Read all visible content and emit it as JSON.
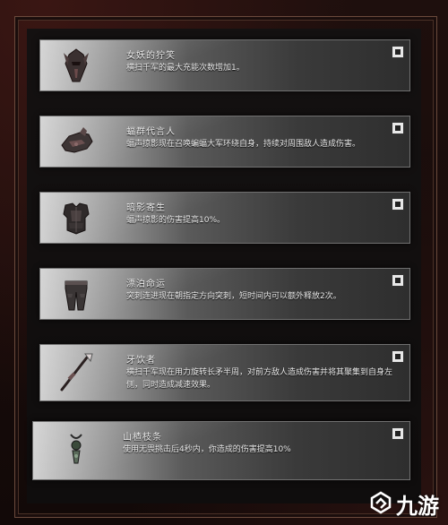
{
  "skills": [
    {
      "title": "女妖的狞笑",
      "desc": "横扫千军的最大充能次数增加1。",
      "icon": "helmet-icon"
    },
    {
      "title": "蝠群代言人",
      "desc": "蝠声掠影现在召唤蝙蝠大军环绕自身，持续对周围敌人造成伤害。",
      "icon": "gauntlet-icon"
    },
    {
      "title": "暗影寄生",
      "desc": "蝠声掠影的伤害提高10%。",
      "icon": "chest-armor-icon"
    },
    {
      "title": "漂泊命运",
      "desc": "突刺连进现在朝指定方向突刺，短时间内可以额外释放2次。",
      "icon": "leg-armor-icon"
    },
    {
      "title": "牙饮者",
      "desc": "横扫千军现在用力旋转长矛半周，对前方敌人造成伤害并将其聚集到自身左侧，同时造成减速效果。",
      "icon": "spear-icon"
    },
    {
      "title": "山楂枝条",
      "desc": "使用无畏挑击后4秒内，你造成的伤害提高10%",
      "icon": "amulet-icon"
    }
  ],
  "watermark": {
    "text": "九游",
    "icon": "jiuyou-logo-icon"
  },
  "colors": {
    "background": "#1a0d0c",
    "frame": "#6b4a3c",
    "text": "#f2f2f2"
  }
}
